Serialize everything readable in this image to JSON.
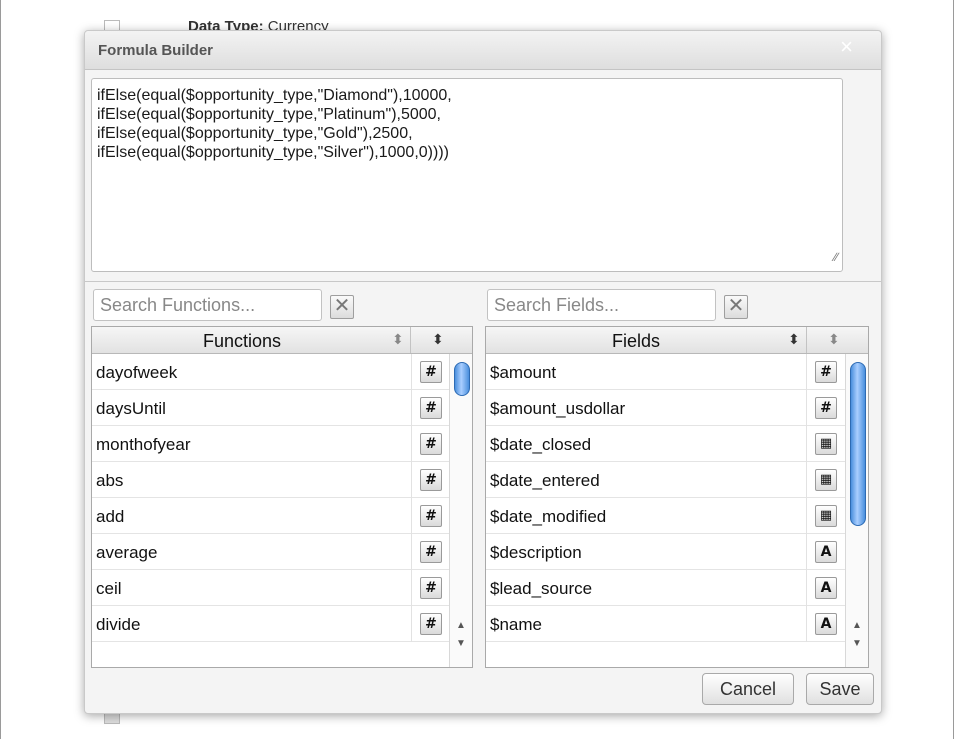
{
  "background": {
    "peek_label": "Data Type:",
    "peek_value": "Currency"
  },
  "dialog": {
    "title": "Formula Builder",
    "close_icon": "×",
    "formula_text": "ifElse(equal($opportunity_type,\"Diamond\"),10000,\nifElse(equal($opportunity_type,\"Platinum\"),5000,\nifElse(equal($opportunity_type,\"Gold\"),2500,\nifElse(equal($opportunity_type,\"Silver\"),1000,0))))"
  },
  "functions_panel": {
    "search_placeholder": "Search Functions...",
    "header": "Functions",
    "items": [
      {
        "name": "dayofweek",
        "type": "number",
        "glyph": "#"
      },
      {
        "name": "daysUntil",
        "type": "number",
        "glyph": "#"
      },
      {
        "name": "monthofyear",
        "type": "number",
        "glyph": "#"
      },
      {
        "name": "abs",
        "type": "number",
        "glyph": "#"
      },
      {
        "name": "add",
        "type": "number",
        "glyph": "#"
      },
      {
        "name": "average",
        "type": "number",
        "glyph": "#"
      },
      {
        "name": "ceil",
        "type": "number",
        "glyph": "#"
      },
      {
        "name": "divide",
        "type": "number",
        "glyph": "#"
      }
    ]
  },
  "fields_panel": {
    "search_placeholder": "Search Fields...",
    "header": "Fields",
    "items": [
      {
        "name": "$amount",
        "type": "number",
        "glyph": "#"
      },
      {
        "name": "$amount_usdollar",
        "type": "number",
        "glyph": "#"
      },
      {
        "name": "$date_closed",
        "type": "date",
        "glyph": "▦"
      },
      {
        "name": "$date_entered",
        "type": "date",
        "glyph": "▦"
      },
      {
        "name": "$date_modified",
        "type": "date",
        "glyph": "▦"
      },
      {
        "name": "$description",
        "type": "text",
        "glyph": "A"
      },
      {
        "name": "$lead_source",
        "type": "text",
        "glyph": "A"
      },
      {
        "name": "$name",
        "type": "text",
        "glyph": "A"
      }
    ]
  },
  "buttons": {
    "cancel": "Cancel",
    "save": "Save"
  },
  "icons": {
    "clear": "✕",
    "sort": "⬍",
    "scroll_up": "▲",
    "scroll_down": "▼",
    "resize": "∕∕"
  }
}
